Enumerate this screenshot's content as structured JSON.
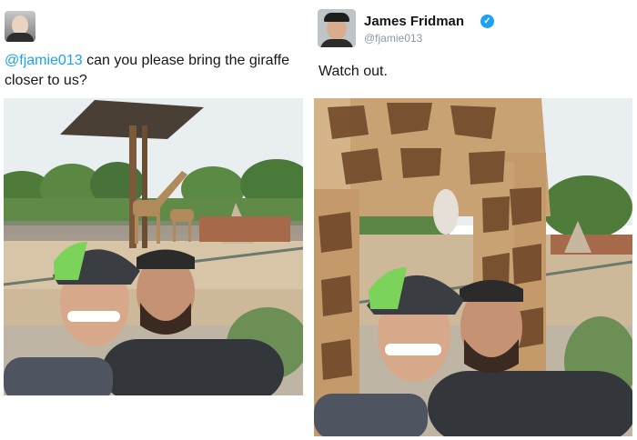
{
  "original_tweet": {
    "mention": "@fjamie013",
    "text": " can you please bring the giraffe closer to us?"
  },
  "reply": {
    "name": "James Fridman",
    "handle": "@fjamie013",
    "text": "Watch out."
  },
  "icons": {
    "verified": "verified-badge-icon"
  },
  "colors": {
    "mention": "#1da1f2",
    "handle": "#8899a6",
    "verified": "#1da1f2"
  }
}
